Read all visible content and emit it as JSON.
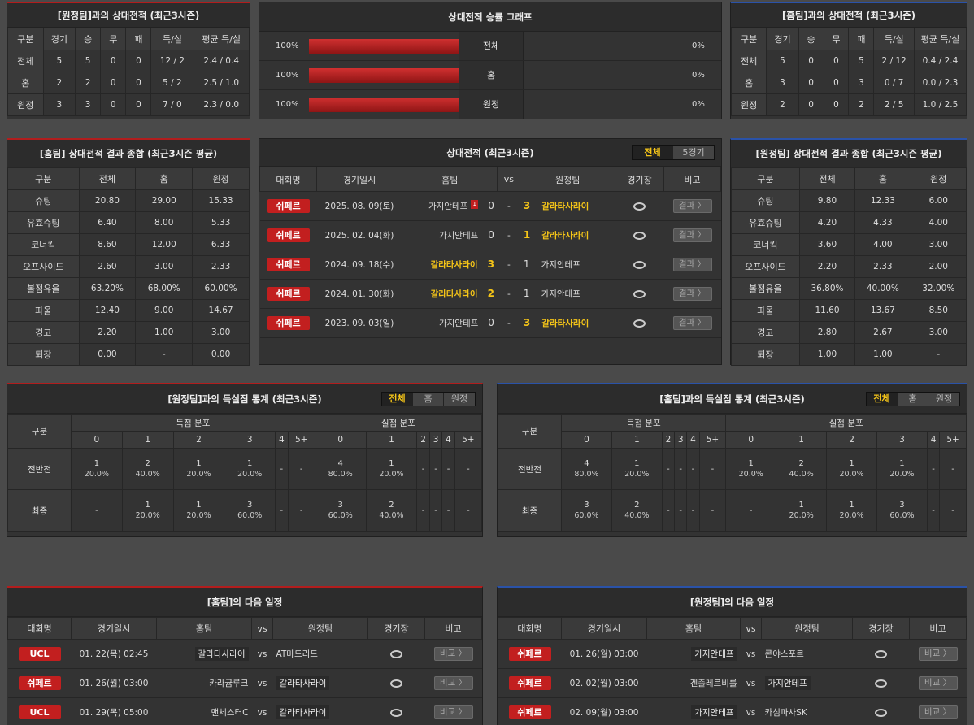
{
  "away_h2h": {
    "title": "[원정팀]과의 상대전적 (최근3시즌)",
    "headers": [
      "구분",
      "경기",
      "승",
      "무",
      "패",
      "득/실",
      "평균 득/실"
    ],
    "rows": [
      [
        "전체",
        "5",
        "5",
        "0",
        "0",
        "12 / 2",
        "2.4 / 0.4"
      ],
      [
        "홈",
        "2",
        "2",
        "0",
        "0",
        "5 / 2",
        "2.5 / 1.0"
      ],
      [
        "원정",
        "3",
        "3",
        "0",
        "0",
        "7 / 0",
        "2.3 / 0.0"
      ]
    ]
  },
  "home_h2h": {
    "title": "[홈팀]과의 상대전적 (최근3시즌)",
    "headers": [
      "구분",
      "경기",
      "승",
      "무",
      "패",
      "득/실",
      "평균 득/실"
    ],
    "rows": [
      [
        "전체",
        "5",
        "0",
        "0",
        "5",
        "2 / 12",
        "0.4 / 2.4"
      ],
      [
        "홈",
        "3",
        "0",
        "0",
        "3",
        "0 / 7",
        "0.0 / 2.3"
      ],
      [
        "원정",
        "2",
        "0",
        "0",
        "2",
        "2 / 5",
        "1.0 / 2.5"
      ]
    ]
  },
  "graph": {
    "title": "상대전적 승률 그래프",
    "rows": [
      {
        "label": "전체",
        "left": "100%",
        "right": "0%",
        "fill": 1.0
      },
      {
        "label": "홈",
        "left": "100%",
        "right": "0%",
        "fill": 1.0
      },
      {
        "label": "원정",
        "left": "100%",
        "right": "0%",
        "fill": 1.0
      }
    ]
  },
  "home_summary": {
    "title": "[홈팀] 상대전적 결과 종합 (최근3시즌 평균)",
    "headers": [
      "구분",
      "전체",
      "홈",
      "원정"
    ],
    "rows": [
      [
        "슈팅",
        "20.80",
        "29.00",
        "15.33"
      ],
      [
        "유효슈팅",
        "6.40",
        "8.00",
        "5.33"
      ],
      [
        "코너킥",
        "8.60",
        "12.00",
        "6.33"
      ],
      [
        "오프사이드",
        "2.60",
        "3.00",
        "2.33"
      ],
      [
        "볼점유율",
        "63.20%",
        "68.00%",
        "60.00%"
      ],
      [
        "파울",
        "12.40",
        "9.00",
        "14.67"
      ],
      [
        "경고",
        "2.20",
        "1.00",
        "3.00"
      ],
      [
        "퇴장",
        "0.00",
        "-",
        "0.00"
      ]
    ]
  },
  "away_summary": {
    "title": "[원정팀] 상대전적 결과 종합 (최근3시즌 평균)",
    "headers": [
      "구분",
      "전체",
      "홈",
      "원정"
    ],
    "rows": [
      [
        "슈팅",
        "9.80",
        "12.33",
        "6.00"
      ],
      [
        "유효슈팅",
        "4.20",
        "4.33",
        "4.00"
      ],
      [
        "코너킥",
        "3.60",
        "4.00",
        "3.00"
      ],
      [
        "오프사이드",
        "2.20",
        "2.33",
        "2.00"
      ],
      [
        "볼점유율",
        "36.80%",
        "40.00%",
        "32.00%"
      ],
      [
        "파울",
        "11.60",
        "13.67",
        "8.50"
      ],
      [
        "경고",
        "2.80",
        "2.67",
        "3.00"
      ],
      [
        "퇴장",
        "1.00",
        "1.00",
        "-"
      ]
    ]
  },
  "matches": {
    "title": "상대전적 (최근3시즌)",
    "tabs": [
      "전체",
      "5경기"
    ],
    "headers": [
      "대회명",
      "경기일시",
      "홈팀",
      "vs",
      "원정팀",
      "경기장",
      "비고"
    ],
    "rows": [
      {
        "league": "쉬페르",
        "date": "2025. 08. 09(토)",
        "home": "가지안테프",
        "card": "1",
        "hs": "0",
        "as": "3",
        "away": "갈라타사라이",
        "win": "away",
        "btn": "결과 〉"
      },
      {
        "league": "쉬페르",
        "date": "2025. 02. 04(화)",
        "home": "가지안테프",
        "card": "",
        "hs": "0",
        "as": "1",
        "away": "갈라타사라이",
        "win": "away",
        "btn": "결과 〉"
      },
      {
        "league": "쉬페르",
        "date": "2024. 09. 18(수)",
        "home": "갈라타사라이",
        "card": "",
        "hs": "3",
        "as": "1",
        "away": "가지안테프",
        "win": "home",
        "btn": "결과 〉"
      },
      {
        "league": "쉬페르",
        "date": "2024. 01. 30(화)",
        "home": "갈라타사라이",
        "card": "",
        "hs": "2",
        "as": "1",
        "away": "가지안테프",
        "win": "home",
        "btn": "결과 〉"
      },
      {
        "league": "쉬페르",
        "date": "2023. 09. 03(일)",
        "home": "가지안테프",
        "card": "",
        "hs": "0",
        "as": "3",
        "away": "갈라타사라이",
        "win": "away",
        "btn": "결과 〉"
      }
    ]
  },
  "dist_left": {
    "title": "[원정팀]과의 득실점 통계 (최근3시즌)",
    "tabs": [
      "전체",
      "홈",
      "원정"
    ],
    "group_label": "구분",
    "scored_label": "득점 분포",
    "conceded_label": "실점 분포",
    "cols": [
      "0",
      "1",
      "2",
      "3",
      "4",
      "5+"
    ],
    "rows": [
      {
        "label": "전반전",
        "cells": [
          [
            "1",
            "20.0%"
          ],
          [
            "2",
            "40.0%"
          ],
          [
            "1",
            "20.0%"
          ],
          [
            "1",
            "20.0%"
          ],
          [
            "-",
            ""
          ],
          [
            "-",
            ""
          ],
          [
            "4",
            "80.0%"
          ],
          [
            "1",
            "20.0%"
          ],
          [
            "-",
            ""
          ],
          [
            "-",
            ""
          ],
          [
            "-",
            ""
          ],
          [
            "-",
            ""
          ]
        ]
      },
      {
        "label": "최종",
        "cells": [
          [
            "-",
            ""
          ],
          [
            "1",
            "20.0%"
          ],
          [
            "1",
            "20.0%"
          ],
          [
            "3",
            "60.0%"
          ],
          [
            "-",
            ""
          ],
          [
            "-",
            ""
          ],
          [
            "3",
            "60.0%"
          ],
          [
            "2",
            "40.0%"
          ],
          [
            "-",
            ""
          ],
          [
            "-",
            ""
          ],
          [
            "-",
            ""
          ],
          [
            "-",
            ""
          ]
        ]
      }
    ]
  },
  "dist_right": {
    "title": "[홈팀]과의 득실점 통계 (최근3시즌)",
    "tabs": [
      "전체",
      "홈",
      "원정"
    ],
    "group_label": "구분",
    "scored_label": "득점 분포",
    "conceded_label": "실점 분포",
    "cols": [
      "0",
      "1",
      "2",
      "3",
      "4",
      "5+"
    ],
    "rows": [
      {
        "label": "전반전",
        "cells": [
          [
            "4",
            "80.0%"
          ],
          [
            "1",
            "20.0%"
          ],
          [
            "-",
            ""
          ],
          [
            "-",
            ""
          ],
          [
            "-",
            ""
          ],
          [
            "-",
            ""
          ],
          [
            "1",
            "20.0%"
          ],
          [
            "2",
            "40.0%"
          ],
          [
            "1",
            "20.0%"
          ],
          [
            "1",
            "20.0%"
          ],
          [
            "-",
            ""
          ],
          [
            "-",
            ""
          ]
        ]
      },
      {
        "label": "최종",
        "cells": [
          [
            "3",
            "60.0%"
          ],
          [
            "2",
            "40.0%"
          ],
          [
            "-",
            ""
          ],
          [
            "-",
            ""
          ],
          [
            "-",
            ""
          ],
          [
            "-",
            ""
          ],
          [
            "-",
            ""
          ],
          [
            "1",
            "20.0%"
          ],
          [
            "1",
            "20.0%"
          ],
          [
            "3",
            "60.0%"
          ],
          [
            "-",
            ""
          ],
          [
            "-",
            ""
          ]
        ]
      }
    ]
  },
  "sched_home": {
    "title": "[홈팀]의 다음 일정",
    "headers": [
      "대회명",
      "경기일시",
      "홈팀",
      "vs",
      "원정팀",
      "경기장",
      "비고"
    ],
    "rows": [
      {
        "league": "UCL",
        "date": "01. 22(목) 02:45",
        "home": "갈라타사라이",
        "away": "AT마드리드",
        "hl": "home",
        "btn": "비교 〉"
      },
      {
        "league": "쉬페르",
        "date": "01. 26(월) 03:00",
        "home": "카라귬루크",
        "away": "갈라타사라이",
        "hl": "away",
        "btn": "비교 〉"
      },
      {
        "league": "UCL",
        "date": "01. 29(목) 05:00",
        "home": "맨체스터C",
        "away": "갈라타사라이",
        "hl": "away",
        "btn": "비교 〉"
      }
    ]
  },
  "sched_away": {
    "title": "[원정팀]의 다음 일정",
    "headers": [
      "대회명",
      "경기일시",
      "홈팀",
      "vs",
      "원정팀",
      "경기장",
      "비고"
    ],
    "rows": [
      {
        "league": "쉬페르",
        "date": "01. 26(월) 03:00",
        "home": "가지안테프",
        "away": "콘야스포르",
        "hl": "home",
        "btn": "비교 〉"
      },
      {
        "league": "쉬페르",
        "date": "02. 02(월) 03:00",
        "home": "겐츨레르비를",
        "away": "가지안테프",
        "hl": "away",
        "btn": "비교 〉"
      },
      {
        "league": "쉬페르",
        "date": "02. 09(월) 03:00",
        "home": "가지안테프",
        "away": "카심파사SK",
        "hl": "home",
        "btn": "비교 〉"
      }
    ]
  },
  "colors": {
    "accent_red": "#c21f1f",
    "highlight": "#f5c518",
    "blue_border": "#2a52a8"
  }
}
